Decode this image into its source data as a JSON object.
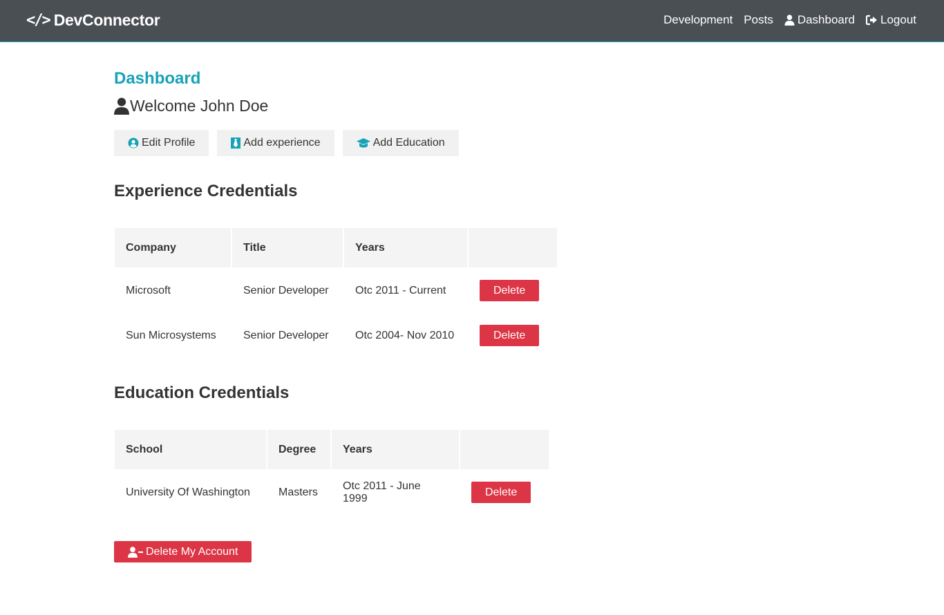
{
  "navbar": {
    "brand_icon": "</>",
    "brand_text": "DevConnector",
    "links": [
      {
        "label": "Development",
        "icon": ""
      },
      {
        "label": "Posts",
        "icon": ""
      },
      {
        "label": "Dashboard",
        "icon": "user-icon"
      },
      {
        "label": "Logout",
        "icon": "sign-out-icon"
      }
    ]
  },
  "page": {
    "title": "Dashboard",
    "welcome": "Welcome John Doe"
  },
  "actions": {
    "edit_profile": "Edit Profile",
    "add_experience": "Add experience",
    "add_education": "Add Education"
  },
  "experience": {
    "title": "Experience Credentials",
    "headers": [
      "Company",
      "Title",
      "Years",
      ""
    ],
    "rows": [
      {
        "company": "Microsoft",
        "title": "Senior Developer",
        "years": "Otc 2011 - Current",
        "action": "Delete"
      },
      {
        "company": "Sun Microsystems",
        "title": "Senior Developer",
        "years": "Otc 2004- Nov 2010",
        "action": "Delete"
      }
    ]
  },
  "education": {
    "title": "Education Credentials",
    "headers": [
      "School",
      "Degree",
      "Years",
      ""
    ],
    "rows": [
      {
        "school": "University Of Washington",
        "degree": "Masters",
        "years": "Otc 2011 - June 1999",
        "action": "Delete"
      }
    ]
  },
  "delete_account": "Delete My Account",
  "colors": {
    "navbar": "#4a4f54",
    "primary": "#17a2b8",
    "danger": "#dc3545",
    "light": "#f4f4f4"
  }
}
